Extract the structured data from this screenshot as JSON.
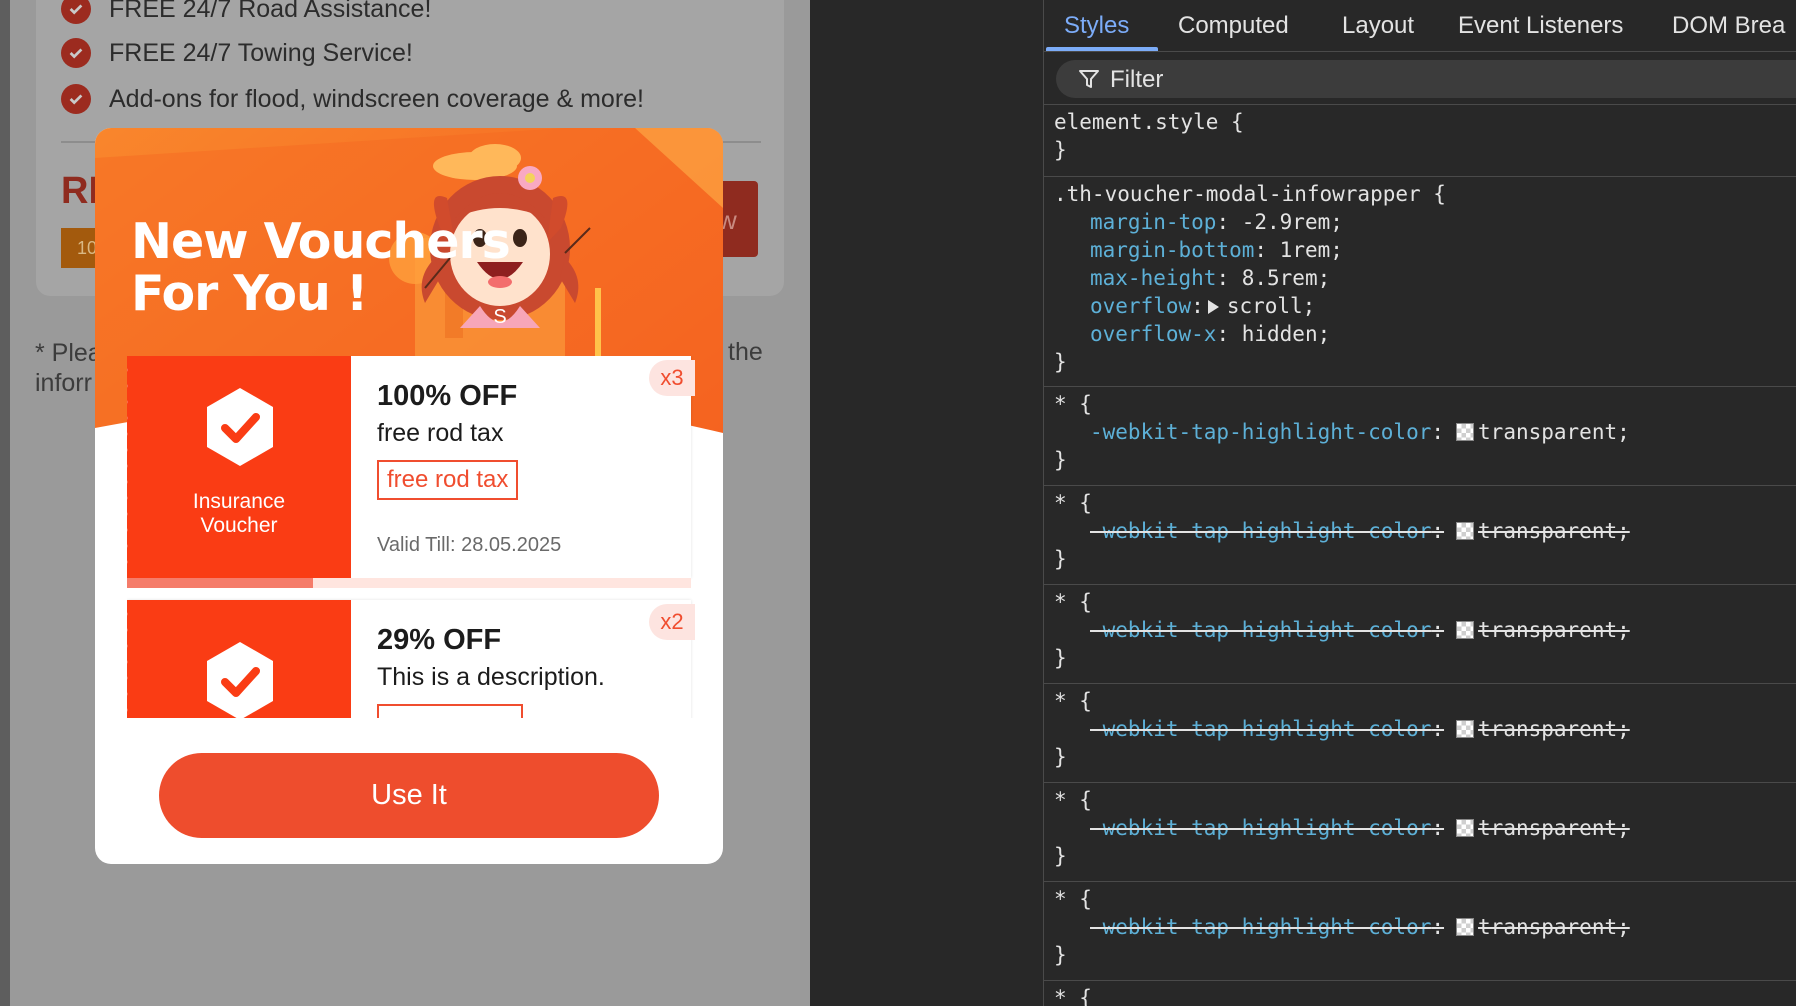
{
  "page": {
    "features": [
      "FREE 24/7 Road Assistance!",
      "FREE 24/7 Towing Service!",
      "Add-ons for flood, windscreen coverage & more!"
    ],
    "price_partial": "RM",
    "price_tag_partial": "10",
    "button_partial": "w",
    "note_line1": "* Plea",
    "note_line2": "inforr",
    "note_right": "the"
  },
  "modal": {
    "title_line1": "New Vouchers",
    "title_line2": "For You !",
    "mascot_badge": "S",
    "vouchers": [
      {
        "type_line1": "Insurance",
        "type_line2": "Voucher",
        "title": "100% OFF",
        "description": "free rod tax",
        "tag": "free rod tax",
        "valid": "Valid Till: 28.05.2025",
        "count": "x3",
        "progress_fraction": 0.33
      },
      {
        "title": "29% OFF",
        "description": "This is a description.",
        "count": "x2"
      }
    ],
    "cta": "Use It",
    "colors": {
      "brand": "#ee4d2d",
      "voucher_left": "#fa3c14",
      "banner": "#f57224"
    }
  },
  "devtools": {
    "tabs": [
      "Styles",
      "Computed",
      "Layout",
      "Event Listeners",
      "DOM Brea"
    ],
    "active_tab": "Styles",
    "filter_placeholder": "Filter",
    "rules": {
      "element_style": {
        "selector": "element.style {",
        "close": "}"
      },
      "infowrapper": {
        "selector": ".th-voucher-modal-infowrapper {",
        "decls": [
          {
            "prop": "margin-top",
            "value": "-2.9rem;"
          },
          {
            "prop": "margin-bottom",
            "value": "1rem;"
          },
          {
            "prop": "max-height",
            "value": "8.5rem;"
          },
          {
            "prop": "overflow",
            "value": "scroll;"
          },
          {
            "prop": "overflow-x",
            "value": "hidden;"
          }
        ],
        "close": "}"
      },
      "universal": {
        "selector": "* {",
        "prop": "-webkit-tap-highlight-color",
        "value": "transparent;",
        "close": "}"
      }
    }
  }
}
